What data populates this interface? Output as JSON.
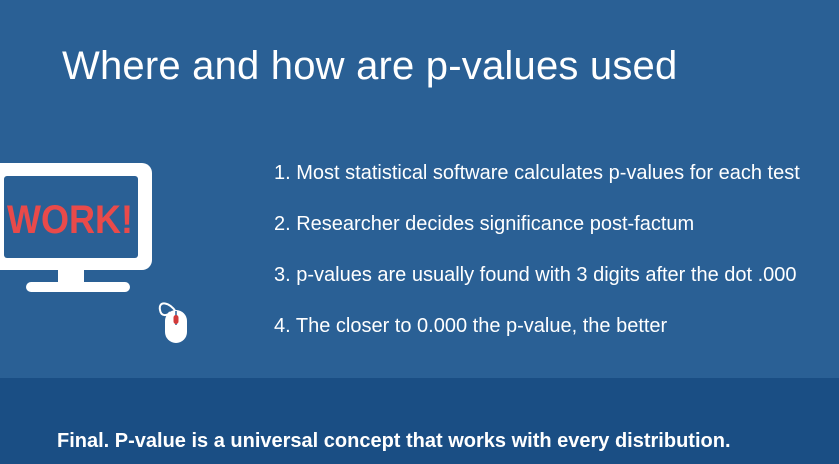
{
  "slide": {
    "title": "Where and how are p-values used",
    "monitor_screen_text": "WORK!",
    "points": [
      "1. Most statistical software calculates p-values for each test",
      "2. Researcher decides significance post-factum",
      "3. p-values are usually found with 3 digits after the dot  .000",
      "4. The closer to 0.000 the p-value, the better"
    ],
    "footer": "Final. P-value is a universal concept that works with every distribution."
  },
  "colors": {
    "background": "#2a6095",
    "footer_band": "#1a4e84",
    "screen_text": "#e94a4a",
    "mouse_wheel": "#d23a3a"
  },
  "icons": [
    "computer-monitor-icon",
    "computer-mouse-icon"
  ]
}
